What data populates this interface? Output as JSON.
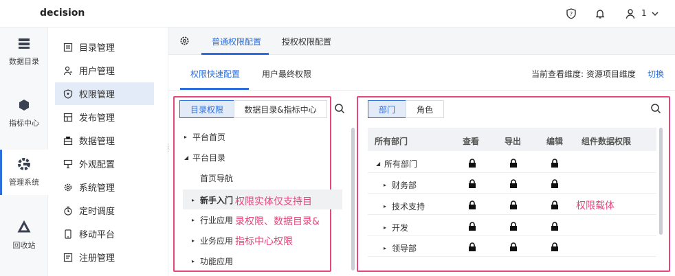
{
  "app": {
    "title": "decision",
    "user_label": "1"
  },
  "rail": [
    {
      "label": "数据目录",
      "icon": "data-catalog-icon"
    },
    {
      "label": "指标中心",
      "icon": "indicator-center-icon"
    },
    {
      "label": "管理系统",
      "icon": "management-system-icon"
    },
    {
      "label": "回收站",
      "icon": "recycle-bin-icon"
    }
  ],
  "menu": [
    {
      "label": "目录管理",
      "icon": "catalog-icon"
    },
    {
      "label": "用户管理",
      "icon": "user-icon"
    },
    {
      "label": "权限管理",
      "icon": "permission-icon"
    },
    {
      "label": "发布管理",
      "icon": "publish-icon"
    },
    {
      "label": "数据管理",
      "icon": "data-icon"
    },
    {
      "label": "外观配置",
      "icon": "appearance-icon"
    },
    {
      "label": "系统管理",
      "icon": "gear-icon"
    },
    {
      "label": "定时调度",
      "icon": "timer-icon"
    },
    {
      "label": "移动平台",
      "icon": "mobile-icon"
    },
    {
      "label": "注册管理",
      "icon": "register-icon"
    }
  ],
  "tabs": {
    "normal": "普通权限配置",
    "grant": "授权权限配置"
  },
  "subtabs": {
    "quick": "权限快速配置",
    "final": "用户最终权限"
  },
  "dimension": {
    "label": "当前查看维度: 资源项目维度",
    "switch": "切换"
  },
  "left_panel": {
    "seg_catalog": "目录权限",
    "seg_data": "数据目录&指标中心",
    "tree": [
      {
        "label": "平台首页",
        "arrow": "▸"
      },
      {
        "label": "平台目录",
        "arrow": "◢"
      },
      {
        "label": "首页导航",
        "arrow": ""
      },
      {
        "label": "新手入门",
        "arrow": "▸"
      },
      {
        "label": "行业应用",
        "arrow": "▸"
      },
      {
        "label": "业务应用",
        "arrow": "▸"
      },
      {
        "label": "功能应用",
        "arrow": "▸"
      }
    ],
    "annotation": [
      "权限实体仅支持目",
      "录权限、数据目录&",
      "指标中心权限"
    ]
  },
  "right_panel": {
    "seg_dept": "部门",
    "seg_role": "角色",
    "columns": [
      "所有部门",
      "查看",
      "导出",
      "编辑",
      "组件数据权限"
    ],
    "rows": [
      {
        "name": "所有部门",
        "arrow": "◢"
      },
      {
        "name": "财务部",
        "arrow": "▸"
      },
      {
        "name": "技术支持",
        "arrow": "▸"
      },
      {
        "name": "开发",
        "arrow": "▸"
      },
      {
        "name": "领导部",
        "arrow": "▸"
      }
    ],
    "annotation": "权限载体"
  }
}
